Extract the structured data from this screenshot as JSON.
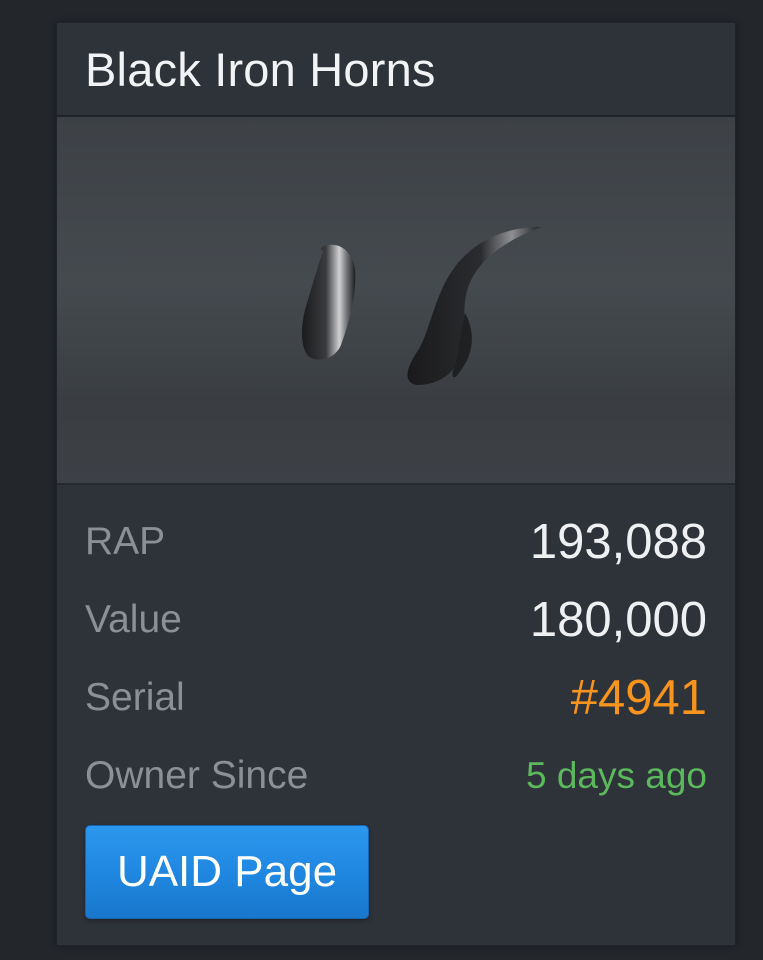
{
  "item": {
    "title": "Black Iron Horns",
    "image_alt": "black-iron-horns-image"
  },
  "stats": [
    {
      "label": "RAP",
      "value": "193,088"
    },
    {
      "label": "Value",
      "value": "180,000"
    },
    {
      "label": "Serial",
      "value": "#4941"
    },
    {
      "label": "Owner Since",
      "value": "5 days ago"
    }
  ],
  "actions": {
    "uaid_button_label": "UAID Page"
  },
  "colors": {
    "background": "#23262b",
    "card": "#2e3239",
    "serial": "#f7941d",
    "owner_since": "#5cb85c",
    "button": "#1f86df"
  }
}
